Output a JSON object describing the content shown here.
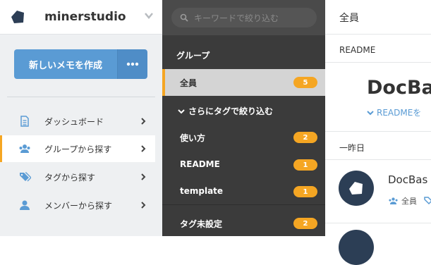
{
  "sidebar": {
    "team_name": "minerstudio",
    "create_button_label": "新しいメモを作成",
    "more_button_icon": "ellipsis-icon",
    "nav": [
      {
        "label": "ダッシュボード",
        "icon": "document-icon",
        "active": false
      },
      {
        "label": "グループから探す",
        "icon": "group-icon",
        "active": true
      },
      {
        "label": "タグから探す",
        "icon": "tags-icon",
        "active": false
      },
      {
        "label": "メンバーから探す",
        "icon": "member-icon",
        "active": false
      }
    ]
  },
  "groups_pane": {
    "search_placeholder": "キーワードで絞り込む",
    "title": "グループ",
    "all": {
      "label": "全員",
      "count": "5"
    },
    "filter_label": "さらにタグで絞り込む",
    "tags": [
      {
        "label": "使い方",
        "count": "2"
      },
      {
        "label": "README",
        "count": "1"
      },
      {
        "label": "template",
        "count": "1"
      }
    ],
    "untagged": {
      "label": "タグ未設定",
      "count": "2"
    }
  },
  "content": {
    "title": "全員",
    "readme_label": "README",
    "big_title": "DocBa",
    "readme_link": "READMEを",
    "date_header": "一昨日",
    "post_title": "DocBas",
    "post_group": "全員"
  },
  "colors": {
    "accent": "#f5a623",
    "primary": "#5a9bd4",
    "dark_pane": "#3b3b3b"
  }
}
